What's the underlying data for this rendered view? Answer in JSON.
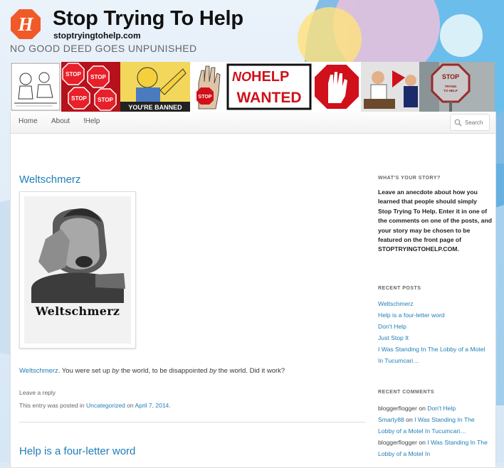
{
  "header": {
    "logo_letter": "H",
    "title": "Stop Trying To Help",
    "url": "stoptryingtohelp.com",
    "description": "NO GOOD DEED GOES UNPUNISHED"
  },
  "banner": {
    "no_help_line1": "NO",
    "no_help_line2": "HELP",
    "no_help_line3": "WANTED",
    "stop_label": "STOP",
    "banned_label": "YOU'RE BANNED",
    "stop_trying_label": "STOP TRYING TO HELP"
  },
  "nav": {
    "items": [
      "Home",
      "About",
      "!Help"
    ],
    "search_placeholder": "Search"
  },
  "posts": [
    {
      "title": "Weltschmerz",
      "image_caption": "Weltschmerz",
      "excerpt_link": "Weltschmerz",
      "excerpt_1": ".  You were set up ",
      "excerpt_em_1": "by",
      "excerpt_2": " the world, to be disappointed ",
      "excerpt_em_2": "by",
      "excerpt_3": " the world.  Did it work?",
      "reply": "Leave a reply",
      "meta_prefix": "This entry was posted in ",
      "category": "Uncategorized",
      "meta_mid": " on ",
      "date": "April 7, 2014",
      "meta_end": "."
    },
    {
      "title": "Help is a four-letter word"
    }
  ],
  "sidebar": {
    "story_title": "WHAT'S YOUR STORY?",
    "story_text": "Leave an anecdote about how you learned that people should simply Stop Trying To Help. Enter it in one of the comments on one of the posts, and your story may be chosen to be featured on the front page of STOPTRYINGTOHELP.COM.",
    "recent_posts_title": "RECENT POSTS",
    "recent_posts": [
      "Weltschmerz",
      "Help is a four-letter word",
      "Don't Help",
      "Just Stop It",
      "I Was Standing In The Lobby of a Motel In Tucumcari…"
    ],
    "recent_comments_title": "RECENT COMMENTS",
    "recent_comments": [
      {
        "author": "bloggerflogger",
        "on": " on ",
        "post": "Don't Help"
      },
      {
        "author": "Smarty88",
        "on": " on ",
        "post": "I Was Standing In The Lobby of a Motel In Tucumcari…"
      },
      {
        "author": "bloggerflogger",
        "on": " on ",
        "post": "I Was Standing In The Lobby of a Motel In"
      }
    ]
  },
  "colors": {
    "link": "#1f7eb8",
    "logo_orange": "#f05a28",
    "stop_red": "#d0101a"
  }
}
